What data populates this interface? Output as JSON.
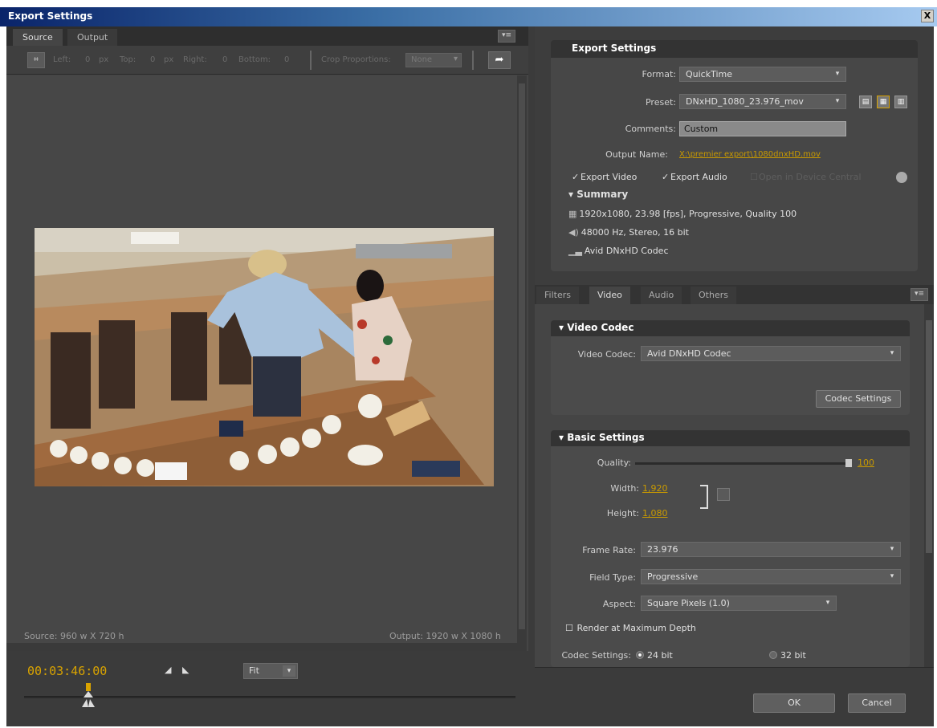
{
  "window": {
    "title": "Export Settings",
    "close_glyph": "X"
  },
  "left": {
    "tabs": [
      "Source",
      "Output"
    ],
    "crop": {
      "left_label": "Left:",
      "left_value": "0",
      "unit1": "px",
      "top_label": "Top:",
      "top_value": "0",
      "unit2": "px",
      "right_label": "Right:",
      "right_value": "0",
      "bottom_label": "Bottom:",
      "bottom_value": "0",
      "proportions_label": "Crop Proportions:",
      "proportions_value": "None"
    },
    "source_info": "Source: 960 w X 720 h",
    "output_info": "Output: 1920 w X 1080 h",
    "timecode": "00:03:46:00",
    "fit_value": "Fit"
  },
  "export_settings": {
    "header": "Export Settings",
    "format_label": "Format:",
    "format_value": "QuickTime",
    "preset_label": "Preset:",
    "preset_value": "DNxHD_1080_23.976_mov",
    "comments_label": "Comments:",
    "comments_value": "Custom",
    "output_name_label": "Output Name:",
    "output_name_value": "X:\\premier export\\1080dnxHD.mov",
    "export_video_label": "Export Video",
    "export_audio_label": "Export Audio",
    "device_central_label": "Open in Device Central",
    "summary_label": "Summary",
    "summary_video": "1920x1080, 23.98 [fps], Progressive, Quality 100",
    "summary_audio": "48000 Hz, Stereo, 16 bit",
    "summary_codec": "Avid DNxHD Codec"
  },
  "right_tabs": [
    "Filters",
    "Video",
    "Audio",
    "Others"
  ],
  "video_codec": {
    "header": "Video Codec",
    "codec_label": "Video Codec:",
    "codec_value": "Avid DNxHD Codec",
    "codec_settings_button": "Codec Settings"
  },
  "basic_settings": {
    "header": "Basic Settings",
    "quality_label": "Quality:",
    "quality_value": "100",
    "quality_fraction": 1.0,
    "width_label": "Width:",
    "width_value": "1,920",
    "height_label": "Height:",
    "height_value": "1,080",
    "frame_rate_label": "Frame Rate:",
    "frame_rate_value": "23.976",
    "field_type_label": "Field Type:",
    "field_type_value": "Progressive",
    "aspect_label": "Aspect:",
    "aspect_value": "Square Pixels (1.0)",
    "render_max_label": "Render at Maximum Depth",
    "codec_settings_label": "Codec Settings:",
    "bit24_label": "24 bit",
    "bit32_label": "32 bit"
  },
  "footer": {
    "ok": "OK",
    "cancel": "Cancel"
  },
  "colors": {
    "accent": "#d9a300",
    "panel": "#454545",
    "titlebar": "#0a246a"
  }
}
